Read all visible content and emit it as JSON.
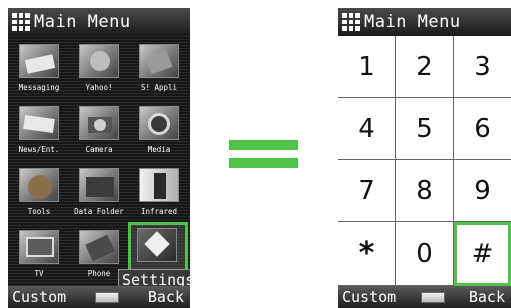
{
  "left_screen": {
    "title": "Main Menu",
    "menu_items": [
      {
        "label": "Messaging",
        "icon": "envelope-icon"
      },
      {
        "label": "Yahoo!",
        "icon": "globe-icon"
      },
      {
        "label": "S! Appli",
        "icon": "app-icon"
      },
      {
        "label": "News/Ent.",
        "icon": "newspaper-icon"
      },
      {
        "label": "Camera",
        "icon": "camera-icon"
      },
      {
        "label": "Media",
        "icon": "media-icon"
      },
      {
        "label": "Tools",
        "icon": "tools-icon"
      },
      {
        "label": "Data Folder",
        "icon": "folder-icon"
      },
      {
        "label": "Infrared",
        "icon": "infrared-icon"
      },
      {
        "label": "TV",
        "icon": "tv-icon"
      },
      {
        "label": "Phone",
        "icon": "phone-book-icon"
      },
      {
        "label": "Settings",
        "icon": "settings-icon",
        "selected": true
      }
    ],
    "selected_label": "Settings",
    "softkeys": {
      "left": "Custom",
      "right": "Back"
    }
  },
  "right_screen": {
    "title": "Main Menu",
    "keys": [
      "1",
      "2",
      "3",
      "4",
      "5",
      "6",
      "7",
      "8",
      "9",
      "*",
      "0",
      "#"
    ],
    "selected_key": "#",
    "softkeys": {
      "left": "Custom",
      "right": "Back"
    }
  },
  "colors": {
    "highlight": "#4fc247",
    "titlebar": "#1a1a1a"
  }
}
